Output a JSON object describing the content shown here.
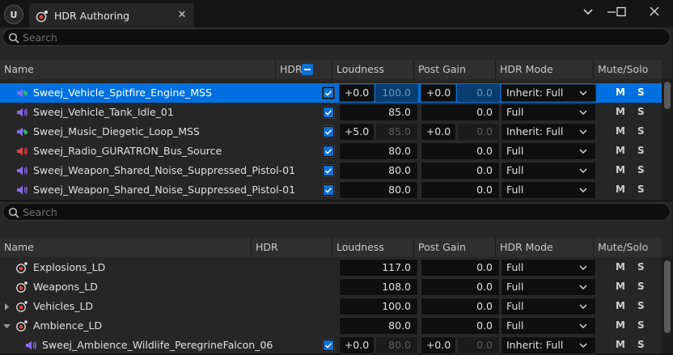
{
  "window": {
    "tab_title": "HDR Authoring",
    "tab_icon": "hdr-sound-icon",
    "app_logo": "U",
    "buttons": [
      "tab-dropdown",
      "minimize",
      "maximize",
      "close"
    ]
  },
  "top": {
    "search_placeholder": "Search",
    "headers": {
      "name": "Name",
      "hdr": "HDR",
      "loudness": "Loudness",
      "postgain": "Post Gain",
      "hdrmode": "HDR Mode",
      "mutesolo": "Mute/Solo"
    },
    "rows": [
      {
        "name": "Sweej_Vehicle_Spitfire_Engine_MSS",
        "icon": "sound-wave-green-icon",
        "hdr": true,
        "loud_off": "+0.0",
        "loud": "100.0",
        "pg_off": "+0.0",
        "pg": "0.0",
        "mode": "Inherit: Full",
        "m": "M",
        "s": "S"
      },
      {
        "name": "Sweej_Vehicle_Tank_Idle_01",
        "icon": "speaker-purple-icon",
        "hdr": true,
        "loud": "85.0",
        "pg": "0.0",
        "mode": "Full",
        "m": "M",
        "s": "S"
      },
      {
        "name": "Sweej_Music_Diegetic_Loop_MSS",
        "icon": "sound-wave-green-icon",
        "hdr": true,
        "loud_off": "+5.0",
        "loud": "85.0",
        "pg_off": "+0.0",
        "pg": "0.0",
        "mode": "Inherit: Full",
        "m": "M",
        "s": "S"
      },
      {
        "name": "Sweej_Radio_GURATRON_Bus_Source",
        "icon": "speaker-red-icon",
        "hdr": true,
        "loud": "80.0",
        "pg": "0.0",
        "mode": "Full",
        "m": "M",
        "s": "S"
      },
      {
        "name": "Sweej_Weapon_Shared_Noise_Suppressed_Pistol-01",
        "icon": "speaker-purple-icon",
        "hdr": true,
        "loud": "80.0",
        "pg": "0.0",
        "mode": "Full",
        "m": "M",
        "s": "S"
      },
      {
        "name": "Sweej_Weapon_Shared_Noise_Suppressed_Pistol-01",
        "icon": "speaker-purple-icon",
        "hdr": true,
        "loud": "80.0",
        "pg": "0.0",
        "mode": "Full",
        "m": "M",
        "s": "S"
      }
    ]
  },
  "bottom": {
    "search_placeholder": "Search",
    "headers": {
      "name": "Name",
      "hdr": "HDR",
      "loudness": "Loudness",
      "postgain": "Post Gain",
      "hdrmode": "HDR Mode",
      "mutesolo": "Mute/Solo"
    },
    "rows": [
      {
        "name": "Explosions_LD",
        "icon": "hdr-sound-icon",
        "loud": "117.0",
        "pg": "0.0",
        "mode": "Full",
        "m": "M",
        "s": "S"
      },
      {
        "name": "Weapons_LD",
        "icon": "hdr-sound-icon",
        "loud": "108.0",
        "pg": "0.0",
        "mode": "Full",
        "m": "M",
        "s": "S"
      },
      {
        "name": "Vehicles_LD",
        "icon": "hdr-sound-icon",
        "expander": "collapsed",
        "loud": "100.0",
        "pg": "0.0",
        "mode": "Full",
        "m": "M",
        "s": "S"
      },
      {
        "name": "Ambience_LD",
        "icon": "hdr-sound-icon",
        "expander": "expanded",
        "loud": "80.0",
        "pg": "0.0",
        "mode": "Full",
        "m": "M",
        "s": "S"
      },
      {
        "name": "Sweej_Ambience_Wildlife_PeregrineFalcon_06",
        "icon": "speaker-purple-icon",
        "hdr": true,
        "loud_off": "+0.0",
        "loud": "80.0",
        "pg_off": "+0.0",
        "pg": "0.0",
        "mode": "Inherit: Full",
        "m": "M",
        "s": "S"
      }
    ]
  },
  "colors": {
    "selection": "#0070e0",
    "checkbox": "#0f70d1",
    "green_icon": "#2fc46a",
    "purple_icon": "#8a6cf0",
    "red_icon": "#e0453a"
  }
}
